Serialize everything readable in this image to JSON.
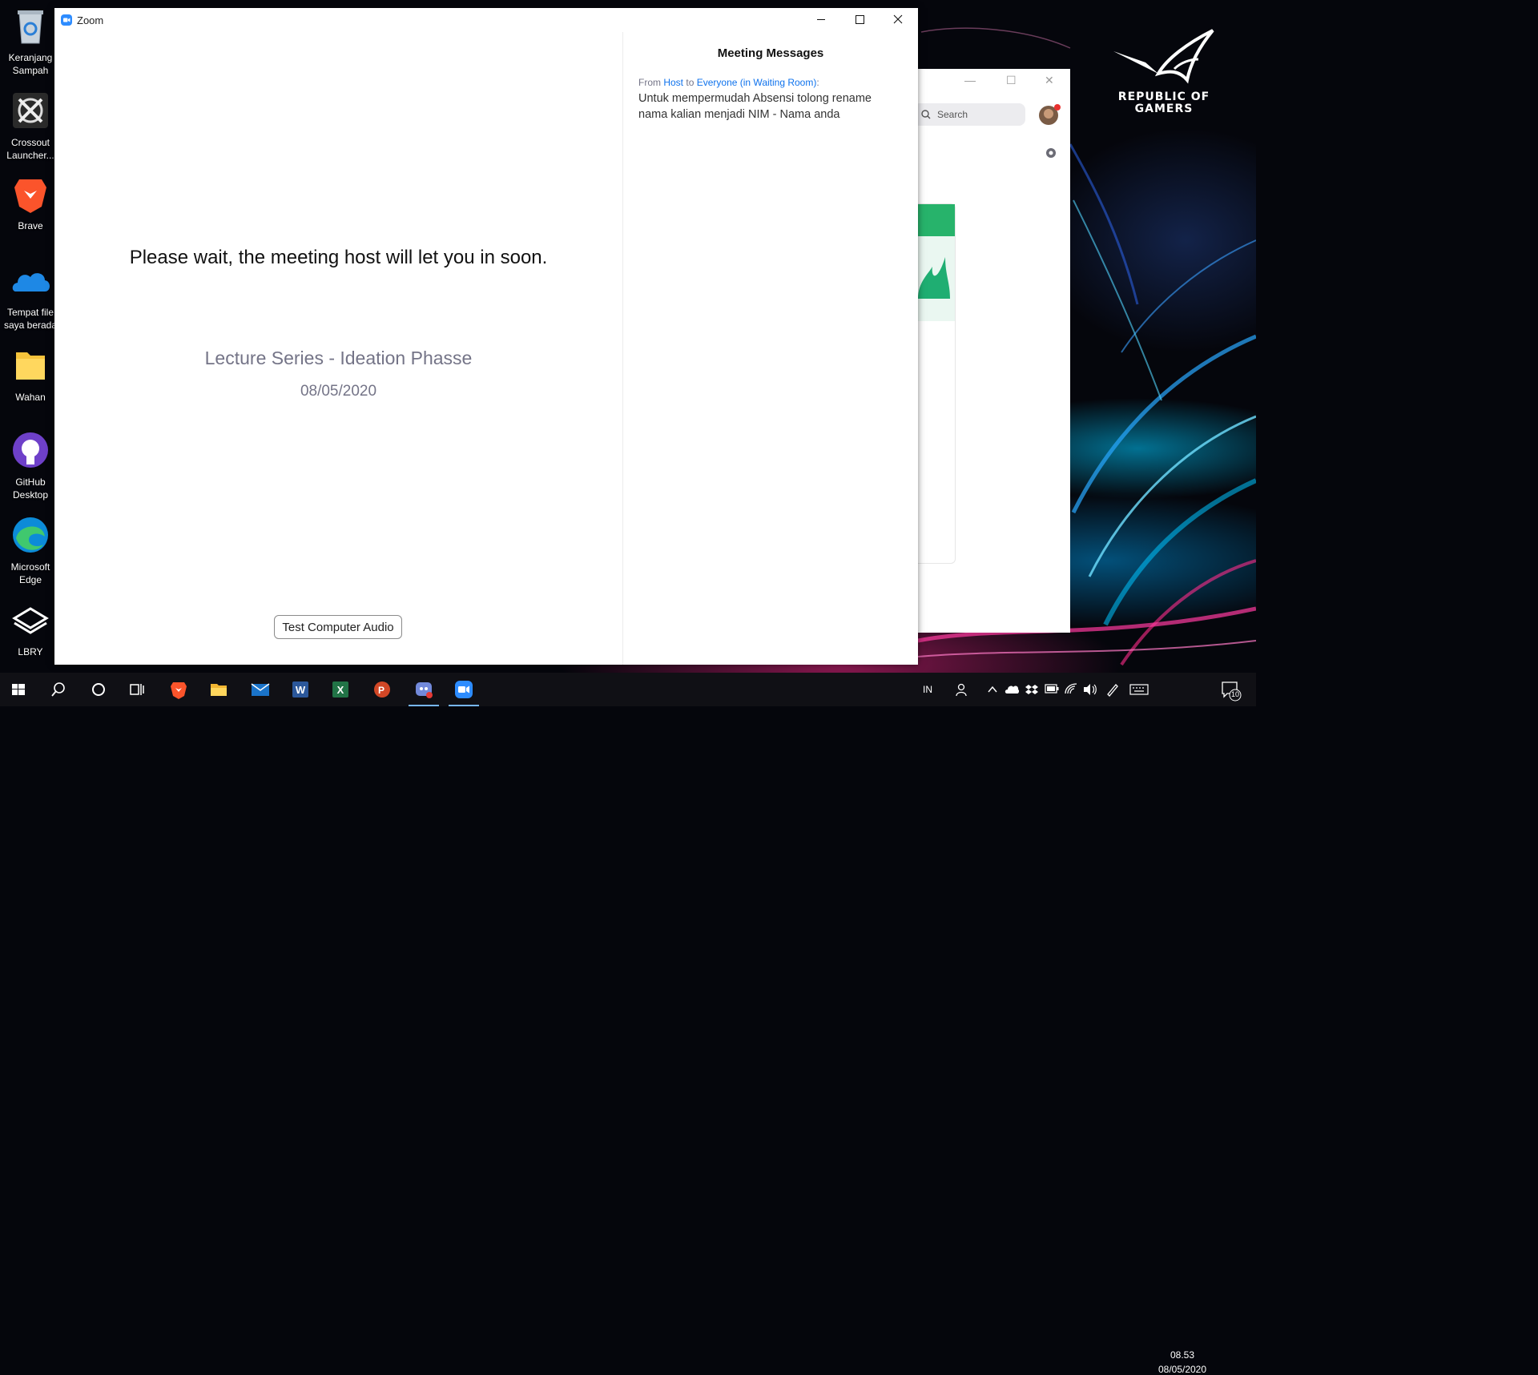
{
  "window": {
    "title": "Zoom",
    "accent": "#2d8cff"
  },
  "waiting_room": {
    "message": "Please wait, the meeting host will let you in soon.",
    "meeting_topic": "Lecture Series - Ideation Phasse",
    "meeting_date": "08/05/2020",
    "test_audio_label": "Test Computer Audio"
  },
  "messages_panel": {
    "title": "Meeting Messages",
    "from_label": "From",
    "sender": "Host",
    "to_label": "to",
    "recipient": "Everyone (in Waiting Room)",
    "colon": ":",
    "body": "Untuk mempermudah Absensi tolong rename nama kalian menjadi NIM - Nama anda"
  },
  "background_window": {
    "search_placeholder": "Search"
  },
  "desktop_icons": [
    {
      "label": "Keranjang Sampah",
      "icon": "recycle-bin-icon"
    },
    {
      "label": "Crossout Launcher...",
      "icon": "crossout-icon"
    },
    {
      "label": "Brave",
      "icon": "brave-icon"
    },
    {
      "label": "Tempat file saya berada",
      "icon": "onedrive-icon"
    },
    {
      "label": "Wahan",
      "icon": "folder-icon"
    },
    {
      "label": "GitHub Desktop",
      "icon": "github-icon"
    },
    {
      "label": "Microsoft Edge",
      "icon": "edge-icon"
    },
    {
      "label": "LBRY",
      "icon": "lbry-icon"
    }
  ],
  "wallpaper": {
    "brand_line1": "REPUBLIC OF",
    "brand_line2": "GAMERS"
  },
  "taskbar": {
    "apps": [
      "start",
      "search",
      "cortana",
      "task-view",
      "brave",
      "file-explorer",
      "mail",
      "word",
      "excel",
      "powerpoint",
      "discord",
      "zoom"
    ],
    "language": "IN",
    "time": "08.53",
    "date": "08/05/2020",
    "notification_count": "10"
  }
}
